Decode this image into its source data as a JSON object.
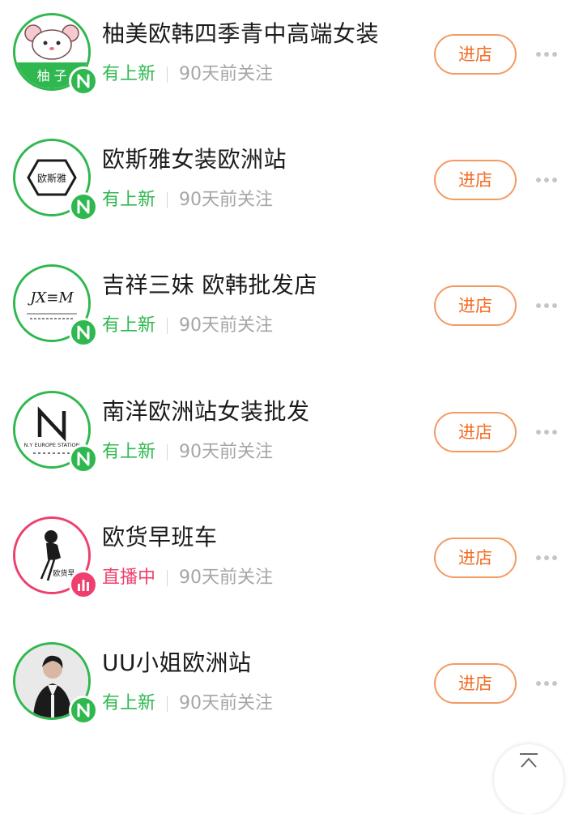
{
  "shops": [
    {
      "name": "柚美欧韩四季青中高端女装",
      "status": "有上新",
      "status_type": "new",
      "followed": "90天前关注",
      "enter_label": "进店",
      "avatar_icon": "cartoon-mouse-logo-icon",
      "avatar_text": "柚 子"
    },
    {
      "name": "欧斯雅女装欧洲站",
      "status": "有上新",
      "status_type": "new",
      "followed": "90天前关注",
      "enter_label": "进店",
      "avatar_icon": "hexagon-logo-icon",
      "avatar_text": "欧斯雅"
    },
    {
      "name": "吉祥三妹 欧韩批发店",
      "status": "有上新",
      "status_type": "new",
      "followed": "90天前关注",
      "enter_label": "进店",
      "avatar_icon": "jxm-monogram-logo-icon",
      "avatar_text": "JX≡M"
    },
    {
      "name": "南洋欧洲站女装批发",
      "status": "有上新",
      "status_type": "new",
      "followed": "90天前关注",
      "enter_label": "进店",
      "avatar_icon": "n-letter-logo-icon",
      "avatar_text": "N.Y EUROPE STATION"
    },
    {
      "name": "欧货早班车",
      "status": "直播中",
      "status_type": "live",
      "followed": "90天前关注",
      "enter_label": "进店",
      "avatar_icon": "woman-silhouette-logo-icon",
      "avatar_text": "欧货早"
    },
    {
      "name": "UU小姐欧洲站",
      "status": "有上新",
      "status_type": "new",
      "followed": "90天前关注",
      "enter_label": "进店",
      "avatar_icon": "woman-photo-avatar-icon",
      "avatar_text": ""
    }
  ],
  "icons": {
    "new_badge": "new-n-badge-icon",
    "live_badge": "live-bars-badge-icon",
    "more": "more-dots-icon",
    "back_to_top": "back-to-top-arrow-icon"
  },
  "colors": {
    "accent_green": "#2fb84f",
    "live_pink": "#ee3f6e",
    "button_orange": "#f26a21",
    "muted_gray": "#a6a6a6"
  }
}
